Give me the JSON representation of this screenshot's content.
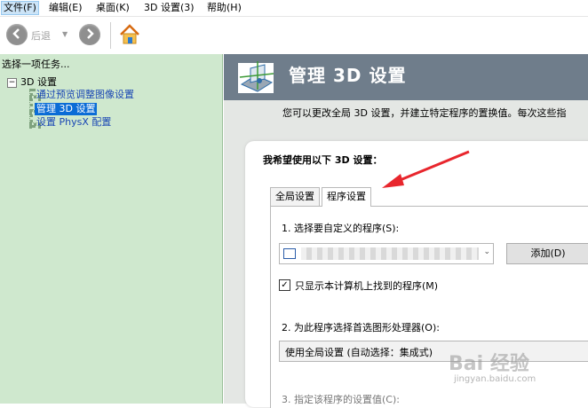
{
  "menu": [
    "文件(F)",
    "编辑(E)",
    "桌面(K)",
    "3D 设置(3)",
    "帮助(H)"
  ],
  "toolbar": {
    "back_label": "后退"
  },
  "left_panel": {
    "title": "选择一项任务...",
    "tree": {
      "root": "3D 设置",
      "items": [
        "通过预览调整图像设置",
        "管理 3D 设置",
        "设置 PhysX 配置"
      ]
    }
  },
  "right_panel": {
    "title": "管理 3D 设置",
    "description": "您可以更改全局 3D 设置，并建立特定程序的置换值。每次这些指",
    "section_heading": "我希望使用以下 3D 设置：",
    "tabs": [
      "全局设置",
      "程序设置"
    ],
    "step1_label": "1. 选择要自定义的程序(S):",
    "add_button": "添加(D)",
    "checkbox_label": "只显示本计算机上找到的程序(M)",
    "step2_label": "2. 为此程序选择首选图形处理器(O):",
    "gpu_select_value": "使用全局设置 (自动选择：集成式)",
    "step3_label": "3. 指定该程序的设置值(C):"
  },
  "watermark": {
    "line1": "Bai 经验",
    "line2": "jingyan.baidu.com"
  },
  "colors": {
    "selection": "#0b6cd6",
    "left_panel_bg": "#cfe8ce",
    "banner_bg": "#6f7d8b",
    "arrow": "#e8262d"
  }
}
